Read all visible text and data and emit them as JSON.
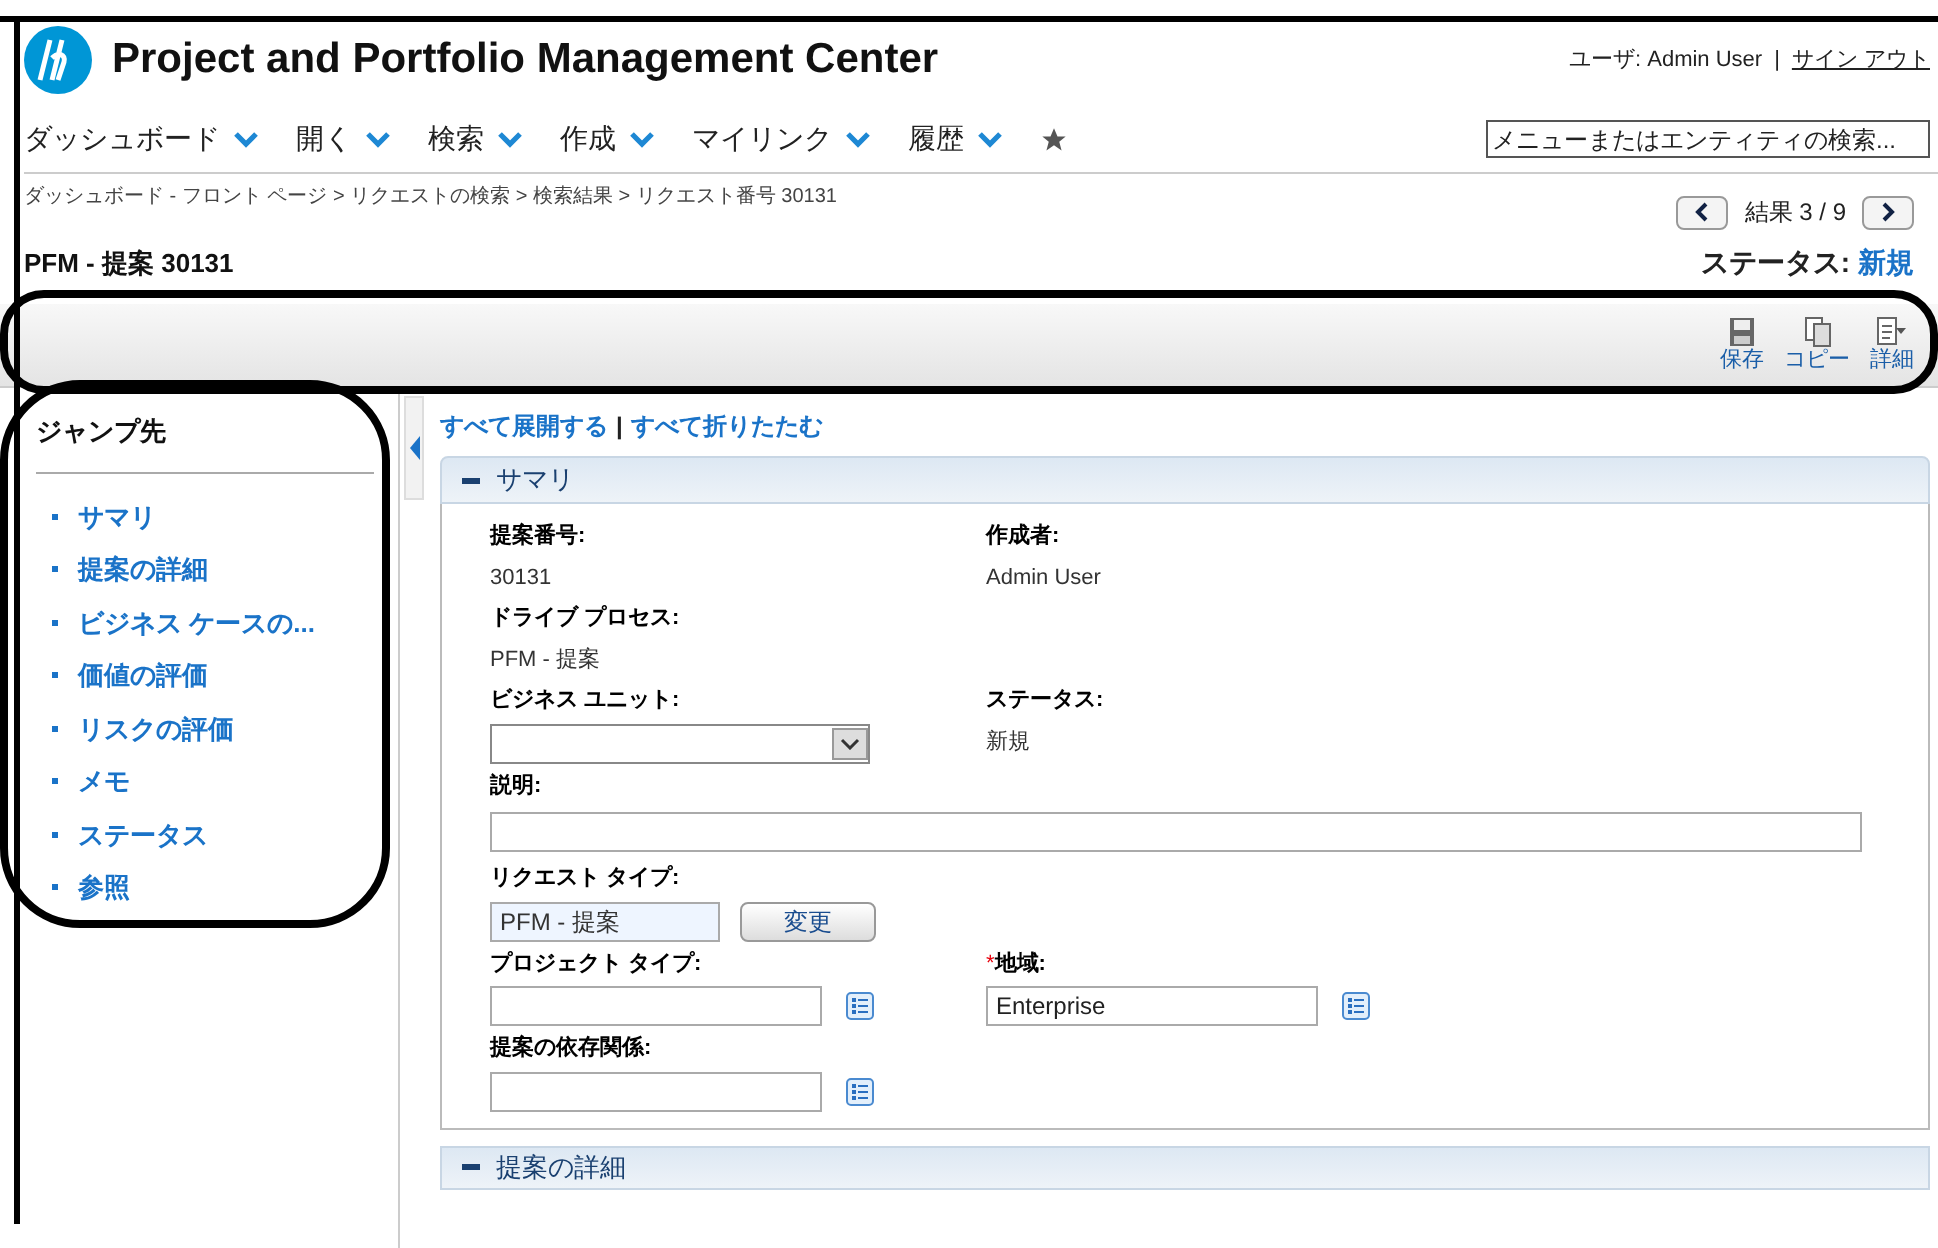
{
  "header": {
    "title": "Project and Portfolio Management Center",
    "user": "ユーザ: Admin User",
    "separator": "|",
    "signout": "サイン アウト"
  },
  "nav": {
    "items": [
      {
        "label": "ダッシュボード"
      },
      {
        "label": "開く"
      },
      {
        "label": "検索"
      },
      {
        "label": "作成"
      },
      {
        "label": "マイリンク"
      },
      {
        "label": "履歴"
      }
    ],
    "search": {
      "placeholder": "メニューまたはエンティティの検索..."
    }
  },
  "breadcrumb": "ダッシュボード - フロント ページ > リクエストの検索 > 検索結果 > リクエスト番号 30131",
  "pager": {
    "text": "結果 3 / 9"
  },
  "page_title": "PFM - 提案 30131",
  "status": {
    "label": "ステータス:",
    "value": "新規"
  },
  "toolbar": [
    {
      "label": "保存",
      "kind": "save"
    },
    {
      "label": "コピー",
      "kind": "copy"
    },
    {
      "label": "詳細",
      "kind": "more"
    }
  ],
  "sidebar": {
    "title": "ジャンプ先",
    "items": [
      {
        "label": "サマリ"
      },
      {
        "label": "提案の詳細"
      },
      {
        "label": "ビジネス ケースの..."
      },
      {
        "label": "価値の評価"
      },
      {
        "label": "リスクの評価"
      },
      {
        "label": "メモ"
      },
      {
        "label": "ステータス"
      },
      {
        "label": "参照"
      }
    ]
  },
  "links": {
    "expand": "すべて展開する",
    "separator": "|",
    "collapse": "すべて折りたたむ"
  },
  "summary": {
    "title": "サマリ",
    "expanded": true,
    "fields": [
      {
        "kind": "text",
        "label": "提案番号:",
        "value": "30131"
      },
      {
        "kind": "text",
        "label": "作成者:",
        "value": "Admin User"
      },
      {
        "kind": "text",
        "label": "ドライブ プロセス:",
        "value": "PFM - 提案",
        "full": true
      },
      {
        "kind": "select",
        "label": "ビジネス ユニット:"
      },
      {
        "kind": "text",
        "label": "ステータス:",
        "value": "新規"
      },
      {
        "kind": "input",
        "label": "説明:",
        "full": true
      },
      {
        "kind": "readonly",
        "label": "リクエスト タイプ:",
        "value": "PFM - 提案",
        "button": "変更",
        "full": true
      },
      {
        "kind": "lookup",
        "label": "プロジェクト タイプ:"
      },
      {
        "kind": "lookup",
        "label": "地域:",
        "required_mark": "*",
        "value": "Enterprise"
      },
      {
        "kind": "lookup",
        "label": "提案の依存関係:",
        "full": true
      }
    ]
  },
  "details": {
    "title": "提案の詳細"
  }
}
